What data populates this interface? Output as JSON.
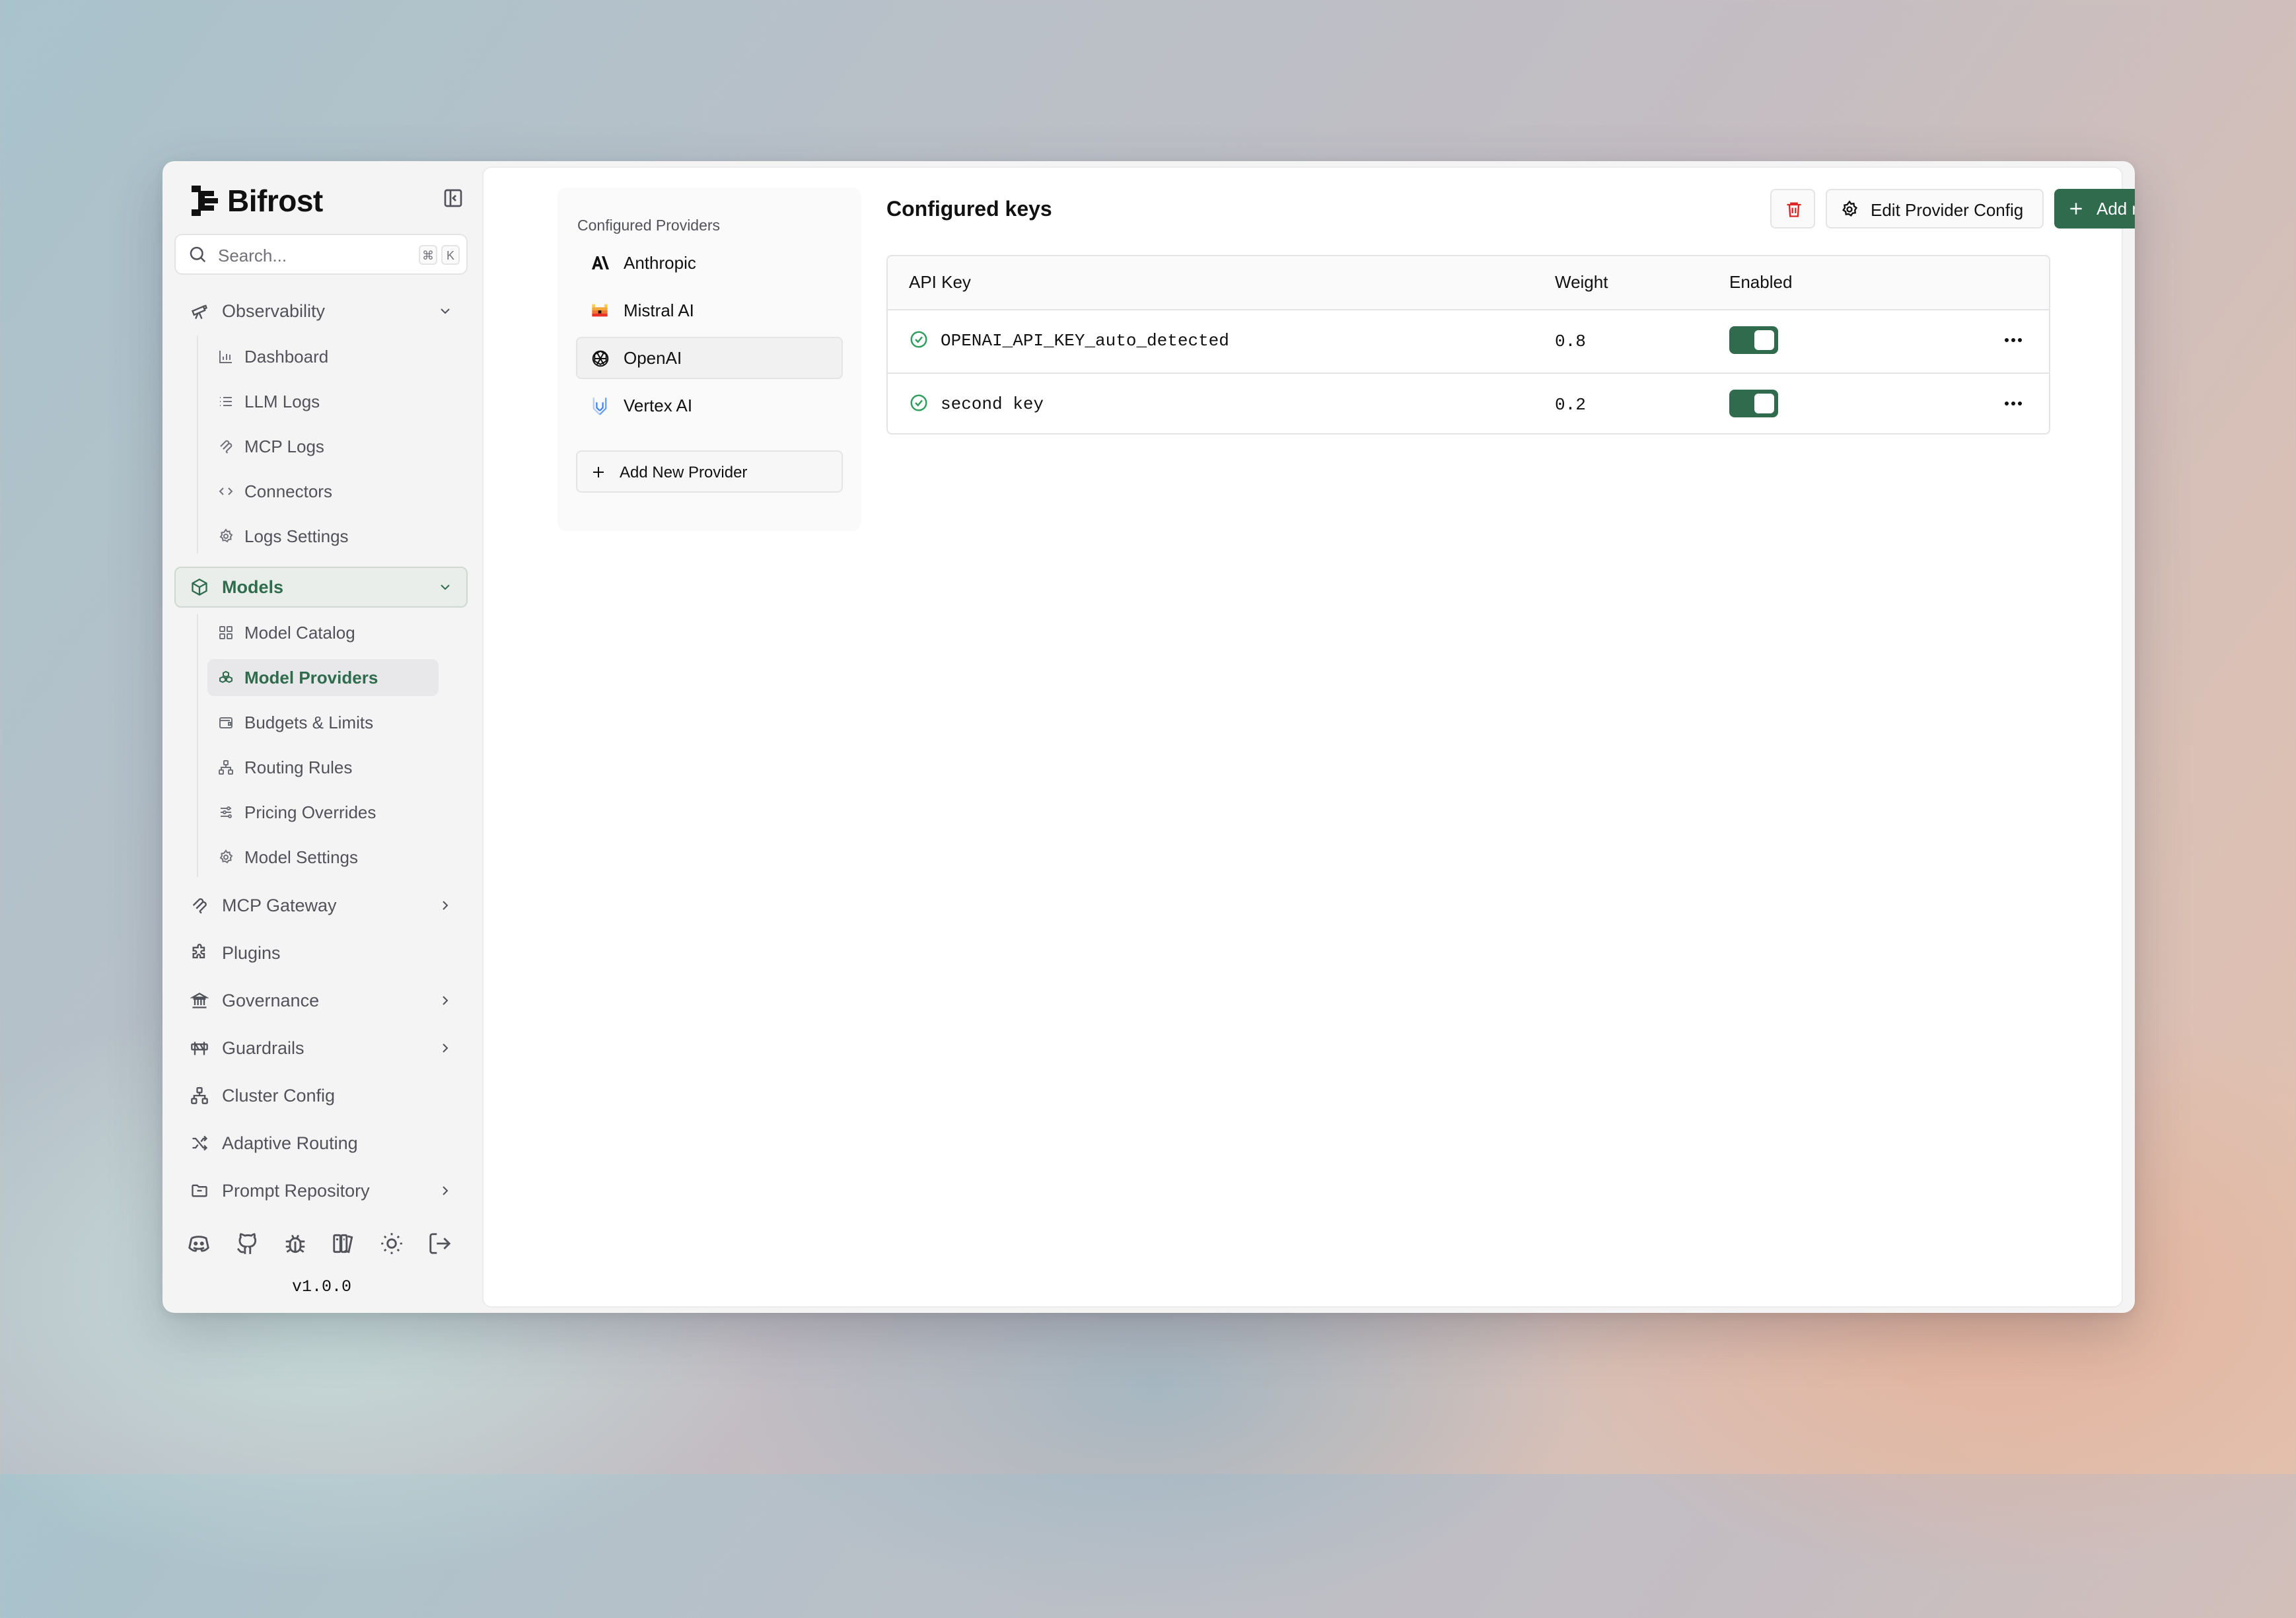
{
  "app": {
    "name": "Bifrost",
    "version": "v1.0.0"
  },
  "search": {
    "placeholder": "Search...",
    "shortcut_mod": "⌘",
    "shortcut_key": "K"
  },
  "sidebar": {
    "observability": {
      "label": "Observability",
      "items": [
        {
          "label": "Dashboard",
          "icon": "bar-chart-icon"
        },
        {
          "label": "LLM Logs",
          "icon": "list-icon"
        },
        {
          "label": "MCP Logs",
          "icon": "mcp-icon"
        },
        {
          "label": "Connectors",
          "icon": "code-arrows-icon"
        },
        {
          "label": "Logs Settings",
          "icon": "gear-icon"
        }
      ]
    },
    "models": {
      "label": "Models",
      "items": [
        {
          "label": "Model Catalog",
          "icon": "grid-icon"
        },
        {
          "label": "Model Providers",
          "icon": "boxes-icon"
        },
        {
          "label": "Budgets & Limits",
          "icon": "wallet-icon"
        },
        {
          "label": "Routing Rules",
          "icon": "network-icon"
        },
        {
          "label": "Pricing Overrides",
          "icon": "sliders-icon"
        },
        {
          "label": "Model Settings",
          "icon": "gear-icon"
        }
      ]
    },
    "groups": [
      {
        "label": "MCP Gateway",
        "icon": "mcp-icon",
        "has_children": true
      },
      {
        "label": "Plugins",
        "icon": "puzzle-icon",
        "has_children": false
      },
      {
        "label": "Governance",
        "icon": "landmark-icon",
        "has_children": true
      },
      {
        "label": "Guardrails",
        "icon": "barrier-icon",
        "has_children": true
      },
      {
        "label": "Cluster Config",
        "icon": "network-icon",
        "has_children": false
      },
      {
        "label": "Adaptive Routing",
        "icon": "shuffle-icon",
        "has_children": false
      },
      {
        "label": "Prompt Repository",
        "icon": "folder-icon",
        "has_children": true
      }
    ],
    "footer_icons": [
      "discord-icon",
      "github-icon",
      "bug-icon",
      "docs-icon",
      "sun-icon",
      "logout-icon"
    ]
  },
  "providers": {
    "title": "Configured Providers",
    "items": [
      {
        "label": "Anthropic",
        "icon": "anthropic-icon"
      },
      {
        "label": "Mistral AI",
        "icon": "mistral-icon"
      },
      {
        "label": "OpenAI",
        "icon": "openai-icon",
        "selected": true
      },
      {
        "label": "Vertex AI",
        "icon": "vertex-icon"
      }
    ],
    "add_label": "Add New Provider"
  },
  "keys": {
    "title": "Configured keys",
    "edit_label": "Edit Provider Config",
    "add_label": "Add new key",
    "columns": [
      "API Key",
      "Weight",
      "Enabled"
    ],
    "rows": [
      {
        "name": "OPENAI_API_KEY_auto_detected",
        "weight": "0.8",
        "enabled": true
      },
      {
        "name": "second key",
        "weight": "0.2",
        "enabled": true
      }
    ]
  },
  "colors": {
    "accent": "#2f6b4c",
    "danger": "#dc2626"
  }
}
